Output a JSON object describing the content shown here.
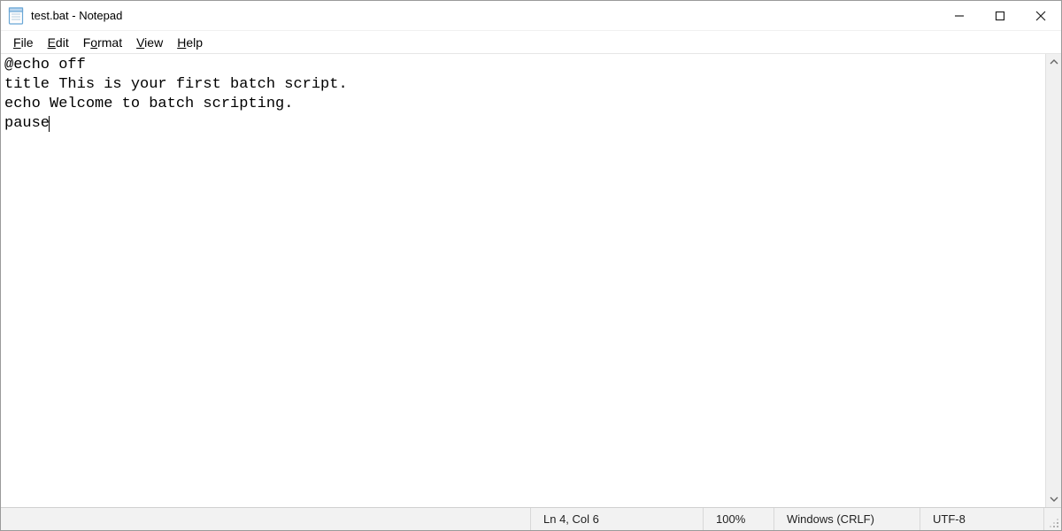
{
  "window": {
    "title": "test.bat - Notepad"
  },
  "menu": {
    "file": {
      "label_pre": "",
      "label_u": "F",
      "label_post": "ile"
    },
    "edit": {
      "label_pre": "",
      "label_u": "E",
      "label_post": "dit"
    },
    "format": {
      "label_pre": "F",
      "label_u": "o",
      "label_post": "rmat"
    },
    "view": {
      "label_pre": "",
      "label_u": "V",
      "label_post": "iew"
    },
    "help": {
      "label_pre": "",
      "label_u": "H",
      "label_post": "elp"
    }
  },
  "editor": {
    "lines": [
      "@echo off",
      "title This is your first batch script.",
      "echo Welcome to batch scripting.",
      "pause"
    ]
  },
  "status": {
    "position": "Ln 4, Col 6",
    "zoom": "100%",
    "line_ending": "Windows (CRLF)",
    "encoding": "UTF-8"
  }
}
